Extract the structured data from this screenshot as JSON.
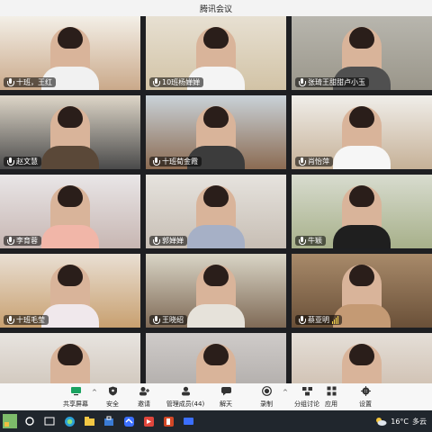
{
  "window": {
    "title": "腾讯会议"
  },
  "participants": [
    {
      "name": "十班，王红",
      "bg": "#f3efe7",
      "room": "#caa98a",
      "shirt": "#f1f1f1"
    },
    {
      "name": "10班杨婵婵",
      "bg": "#e7e0d2",
      "room": "#d2c3a6",
      "shirt": "#f4f4f4"
    },
    {
      "name": "张琦王甜甜卢小玉",
      "bg": "#b8b6ae",
      "room": "#9a968a",
      "shirt": "#505050"
    },
    {
      "name": "赵文慧",
      "bg": "#ded6c8",
      "room": "#4a4a4a",
      "shirt": "#5a4838"
    },
    {
      "name": "十班荀金霞",
      "bg": "#c9d2d8",
      "room": "#8b6b52",
      "shirt": "#3c3c3c"
    },
    {
      "name": "肖怡萍",
      "bg": "#f0eeea",
      "room": "#c6b197",
      "shirt": "#f6f6f6"
    },
    {
      "name": "李育蓉",
      "bg": "#e9e6e7",
      "room": "#c7b6b2",
      "shirt": "#f1b6a8"
    },
    {
      "name": "郭婵婵",
      "bg": "#e6e3de",
      "room": "#c7beb4",
      "shirt": "#a6b0c6"
    },
    {
      "name": "牛颖",
      "bg": "#d8dccf",
      "room": "#a7b08a",
      "shirt": "#1f1f1f"
    },
    {
      "name": "十班毛莹",
      "bg": "#e9dfd3",
      "room": "#c8a070",
      "shirt": "#f0e8ec"
    },
    {
      "name": "王晓绍",
      "bg": "#d9d5c6",
      "room": "#7f6a56",
      "shirt": "#e6e2da"
    },
    {
      "name": "蔡亚明",
      "bg": "#a88a6a",
      "room": "#6a5038",
      "shirt": "#c49a74"
    },
    {
      "name": "",
      "bg": "#e8e4e0",
      "room": "#c9beb1",
      "shirt": "#f0f0f0"
    },
    {
      "name": "",
      "bg": "#cfcbc9",
      "room": "#a9a5a2",
      "shirt": "#2a2a2a"
    },
    {
      "name": "",
      "bg": "#e5dfd8",
      "room": "#c9b7a6",
      "shirt": "#d6d6de"
    }
  ],
  "toolbar": {
    "items": [
      {
        "label": "共享屏幕",
        "icon": "share-screen-icon",
        "caret": true
      },
      {
        "label": "安全",
        "icon": "shield-icon",
        "caret": false
      },
      {
        "label": "邀请",
        "icon": "invite-icon",
        "caret": false
      },
      {
        "label": "管理成员(44)",
        "icon": "members-icon",
        "caret": false
      },
      {
        "label": "解天",
        "icon": "chat-icon",
        "caret": false
      },
      {
        "label": "录制",
        "icon": "record-icon",
        "caret": true
      },
      {
        "label": "分组讨论",
        "icon": "breakout-icon",
        "caret": false
      },
      {
        "label": "应用",
        "icon": "apps-icon",
        "caret": false
      },
      {
        "label": "设置",
        "icon": "settings-icon",
        "caret": false
      }
    ]
  },
  "taskbar": {
    "weather": {
      "temp": "16°C",
      "condition": "多云"
    }
  },
  "colors": {
    "accent": "#4a7dff",
    "record": "#222222"
  }
}
